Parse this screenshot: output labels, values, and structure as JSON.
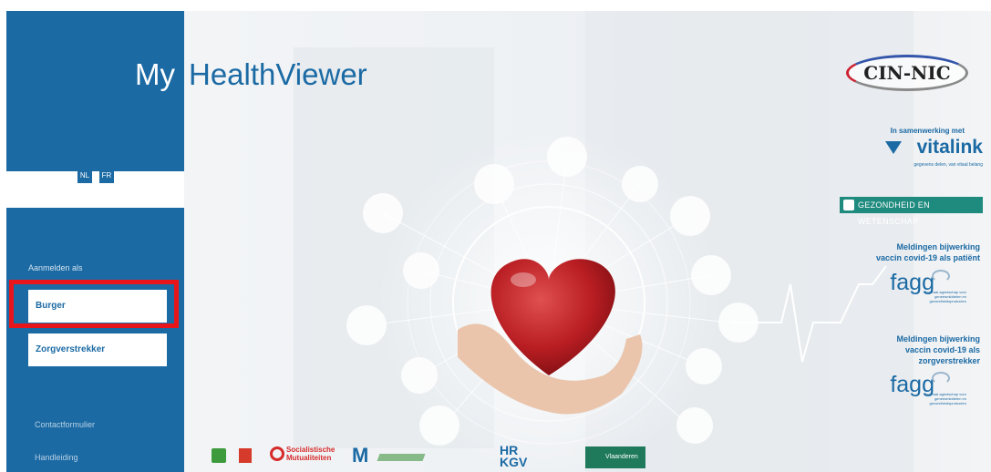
{
  "brand": {
    "prefix": "My",
    "name": "HealthViewer"
  },
  "languages": [
    "NL",
    "FR"
  ],
  "login": {
    "label": "Aanmelden als",
    "options": [
      "Burger",
      "Zorgverstrekker"
    ]
  },
  "footer_links": [
    "Contactformulier",
    "Handleiding"
  ],
  "partners": {
    "cin_nic": "CIN-NIC",
    "collab_label": "In samenwerking met",
    "vitalink": "vitalink",
    "vitalink_tagline": "gegevens delen, van vitaal belang",
    "gezondheid": "GEZONDHEID EN WETENSCHAP"
  },
  "reports": [
    {
      "text": "Meldingen bijwerking vaccin covid-19 als patiënt",
      "logo": "fagg"
    },
    {
      "text": "Meldingen bijwerking vaccin covid-19 als zorgverstrekker",
      "logo": "fagg"
    }
  ],
  "fagg_tagline": "federaal agentschap voor geneesmiddelen en gezondheidsproducten",
  "bottom_logos": [
    "Socialistische",
    "Mutualiteiten",
    "M",
    "HR",
    "KGV",
    "Vlaanderen"
  ],
  "colors": {
    "primary": "#1b6aa4",
    "highlight": "#e8151b",
    "teal": "#1f8a7e"
  }
}
